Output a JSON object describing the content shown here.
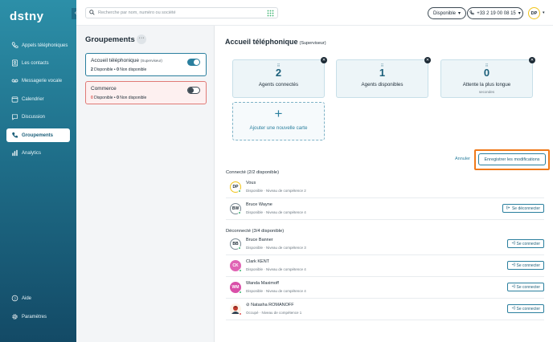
{
  "app": {
    "logo": "dstny"
  },
  "sidebar": {
    "items": [
      {
        "label": "Appels téléphoniques",
        "icon": "phone-icon",
        "active": false
      },
      {
        "label": "Les contacts",
        "icon": "contacts-icon",
        "active": false
      },
      {
        "label": "Messagerie vocale",
        "icon": "voicemail-icon",
        "active": false
      },
      {
        "label": "Calendrier",
        "icon": "calendar-icon",
        "active": false
      },
      {
        "label": "Discussion",
        "icon": "chat-icon",
        "active": false
      },
      {
        "label": "Groupements",
        "icon": "group-phone-icon",
        "active": true
      },
      {
        "label": "Analytics",
        "icon": "analytics-icon",
        "active": false
      }
    ],
    "bottom": [
      {
        "label": "Aide",
        "icon": "help-icon"
      },
      {
        "label": "Paramètres",
        "icon": "gear-icon"
      }
    ]
  },
  "topbar": {
    "search_placeholder": "Recherche par nom, numéro ou société",
    "status": "Disponible",
    "phone": "+33 2 19 00 08 15",
    "avatar": "DP"
  },
  "groups": {
    "title": "Groupements",
    "more": "···",
    "items": [
      {
        "name": "Accueil téléphonique",
        "role": "(Superviseur)",
        "available": "2",
        "available_label": "Disponible",
        "unavailable": "0",
        "unavailable_label": "Non disponible",
        "enabled": true
      },
      {
        "name": "Commerce",
        "role": "",
        "available": "0",
        "available_label": "Disponible",
        "unavailable": "0",
        "unavailable_label": "Non disponible",
        "enabled": false
      }
    ]
  },
  "main": {
    "title": "Accueil téléphonique",
    "role": "(Superviseur)",
    "cards": [
      {
        "value": "2",
        "label": "Agents connectés",
        "unit": ""
      },
      {
        "value": "1",
        "label": "Agents disponibles",
        "unit": ""
      },
      {
        "value": "0",
        "label": "Attente la plus longue",
        "unit": "secondes"
      }
    ],
    "add_card": {
      "plus": "+",
      "label": "Ajouter une nouvelle carte"
    },
    "cancel": "Annuler",
    "save": "Enregistrer les modifications",
    "connected_title": "Connecté (2/2 disponible)",
    "disconnected_title": "Déconnecté (3/4 disponible)",
    "connected": [
      {
        "initials": "DP",
        "name": "Vous",
        "status": "Disponible · Niveau de compétence 2",
        "avatar_bg": "#ffffff",
        "avatar_border": "#f0c419",
        "dot": "ok",
        "button": ""
      },
      {
        "initials": "BW",
        "name": "Bruce Wayne",
        "status": "Disponible · Niveau de compétence 4",
        "avatar_bg": "#ffffff",
        "avatar_border": "#7a8a94",
        "dot": "ok",
        "button": "Se déconnecter"
      }
    ],
    "disconnected": [
      {
        "initials": "BB",
        "name": "Bruce Banner",
        "status": "Disponible · Niveau de compétence 3",
        "avatar_bg": "#ffffff",
        "avatar_border": "#7a8a94",
        "dot": "ok",
        "button": "Se connecter"
      },
      {
        "initials": "CK",
        "name": "Clark KENT",
        "status": "Disponible · Niveau de compétence 4",
        "avatar_bg": "#e064b4",
        "avatar_border": "#e064b4",
        "dot": "ok",
        "button": "Se connecter"
      },
      {
        "initials": "WM",
        "name": "Wanda Maximoff",
        "status": "Disponible · Niveau de compétence 4",
        "avatar_bg": "#d94fa8",
        "avatar_border": "#d94fa8",
        "dot": "ok",
        "button": "Se connecter"
      },
      {
        "initials": "",
        "name": "⊘ Natasha ROMANOFF",
        "status": "Occupé · Niveau de compétence 1",
        "avatar_bg": "#c0392b",
        "avatar_border": "#c0392b",
        "dot": "busy",
        "button": "Se connecter"
      }
    ]
  }
}
